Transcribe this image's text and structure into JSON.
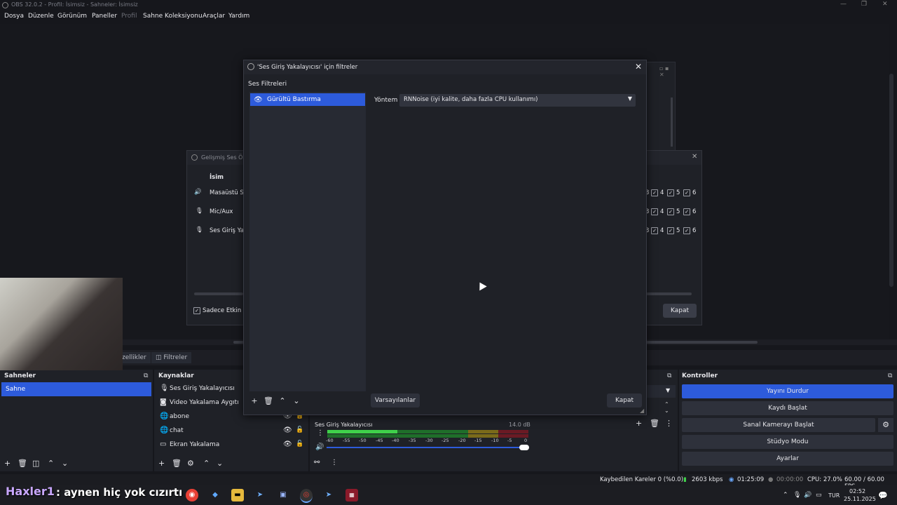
{
  "window": {
    "title": "OBS 32.0.2 - Profil: İsimsiz - Sahneler: İsimsiz"
  },
  "menu": [
    "Dosya",
    "Düzenle",
    "Görünüm",
    "Paneller",
    "Profil",
    "Sahne Koleksiyonu",
    "Araçlar",
    "Yardım"
  ],
  "filter_dialog": {
    "title": "'Ses Giriş Yakalayıcısı' için filtreler",
    "section_label": "Ses Filtreleri",
    "filters": [
      {
        "name": "Gürültü Bastırma",
        "visible": true
      }
    ],
    "method_label": "Yöntem",
    "method_value": "RNNoise (iyi kalite, daha fazla CPU kullanımı)",
    "defaults_button": "Varsayılanlar",
    "close_button": "Kapat"
  },
  "advanced_audio": {
    "title": "Gelişmiş Ses Özel",
    "column_name": "İsim",
    "rows": [
      {
        "name": "Masaüstü Se",
        "icon": "speaker-icon"
      },
      {
        "name": "Mic/Aux",
        "icon": "mic-icon"
      },
      {
        "name": "Ses Giriş Yak",
        "icon": "mic-icon"
      }
    ],
    "track_labels": [
      "3",
      "4",
      "5",
      "6"
    ],
    "only_active": "Sadece Etkin K",
    "close_button": "Kapat"
  },
  "tabs": {
    "properties": "zellikler",
    "filters": "Filtreler"
  },
  "scenes": {
    "title": "Sahneler",
    "items": [
      "Sahne"
    ]
  },
  "sources": {
    "title": "Kaynaklar",
    "items": [
      {
        "name": "Ses Giriş Yakalayıcısı",
        "icon": "mic-icon",
        "eye": false
      },
      {
        "name": "Video Yakalama Aygıtı",
        "icon": "camera-icon",
        "eye": false
      },
      {
        "name": "abone",
        "icon": "globe-icon",
        "eye": true
      },
      {
        "name": "chat",
        "icon": "globe-icon",
        "eye": true
      },
      {
        "name": "Ekran Yakalama",
        "icon": "monitor-icon",
        "eye": true
      }
    ]
  },
  "mixer": {
    "channel_name": "Ses Giriş Yakalayıcısı",
    "db_value": "14.0 dB",
    "scale": [
      "-60",
      "-55",
      "-50",
      "-45",
      "-40",
      "-35",
      "-30",
      "-25",
      "-20",
      "-15",
      "-10",
      "-5",
      "0"
    ],
    "level_fraction": 0.35
  },
  "controls": {
    "title": "Kontroller",
    "buttons": [
      "Yayını Durdur",
      "Kaydı Başlat",
      "Sanal Kamerayı Başlat",
      "Stüdyo Modu",
      "Ayarlar"
    ]
  },
  "status": {
    "dropped": "Kaybedilen Kareler 0 (%0.0)",
    "bitrate": "2603 kbps",
    "stream_time": "01:25:09",
    "rec_time": "00:00:00",
    "cpu": "CPU: 27.0%",
    "fps": "60.00 / 60.00 FPS"
  },
  "overlay": {
    "username": "Haxler1",
    "message": ": aynen hiç yok cızırtı"
  },
  "taskbar": {
    "lang": "TUR",
    "time": "02:52",
    "date": "25.11.2025"
  },
  "colors": {
    "accent": "#2d5bdb",
    "bg": "#1f2127",
    "dark": "#16171c"
  }
}
